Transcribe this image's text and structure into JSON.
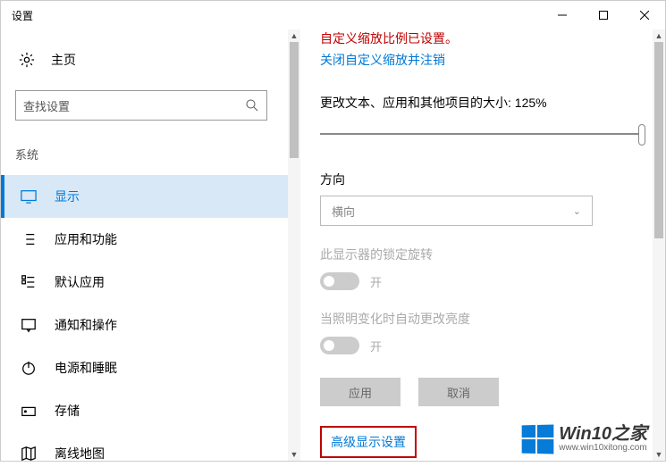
{
  "window": {
    "title": "设置"
  },
  "left": {
    "home": "主页",
    "search_placeholder": "查找设置",
    "section": "系统",
    "items": [
      {
        "label": "显示"
      },
      {
        "label": "应用和功能"
      },
      {
        "label": "默认应用"
      },
      {
        "label": "通知和操作"
      },
      {
        "label": "电源和睡眠"
      },
      {
        "label": "存储"
      },
      {
        "label": "离线地图"
      }
    ]
  },
  "right": {
    "warning": "自定义缩放比例已设置。",
    "signout_link": "关闭自定义缩放并注销",
    "scale_label": "更改文本、应用和其他项目的大小: 125%",
    "orientation_label": "方向",
    "orientation_value": "横向",
    "rotation_lock_label": "此显示器的锁定旋转",
    "rotation_lock_value": "开",
    "brightness_label": "当照明变化时自动更改亮度",
    "brightness_value": "开",
    "apply": "应用",
    "cancel": "取消",
    "advanced": "高级显示设置"
  },
  "watermark": {
    "text": "Win10之家",
    "url": "www.win10xitong.com"
  }
}
